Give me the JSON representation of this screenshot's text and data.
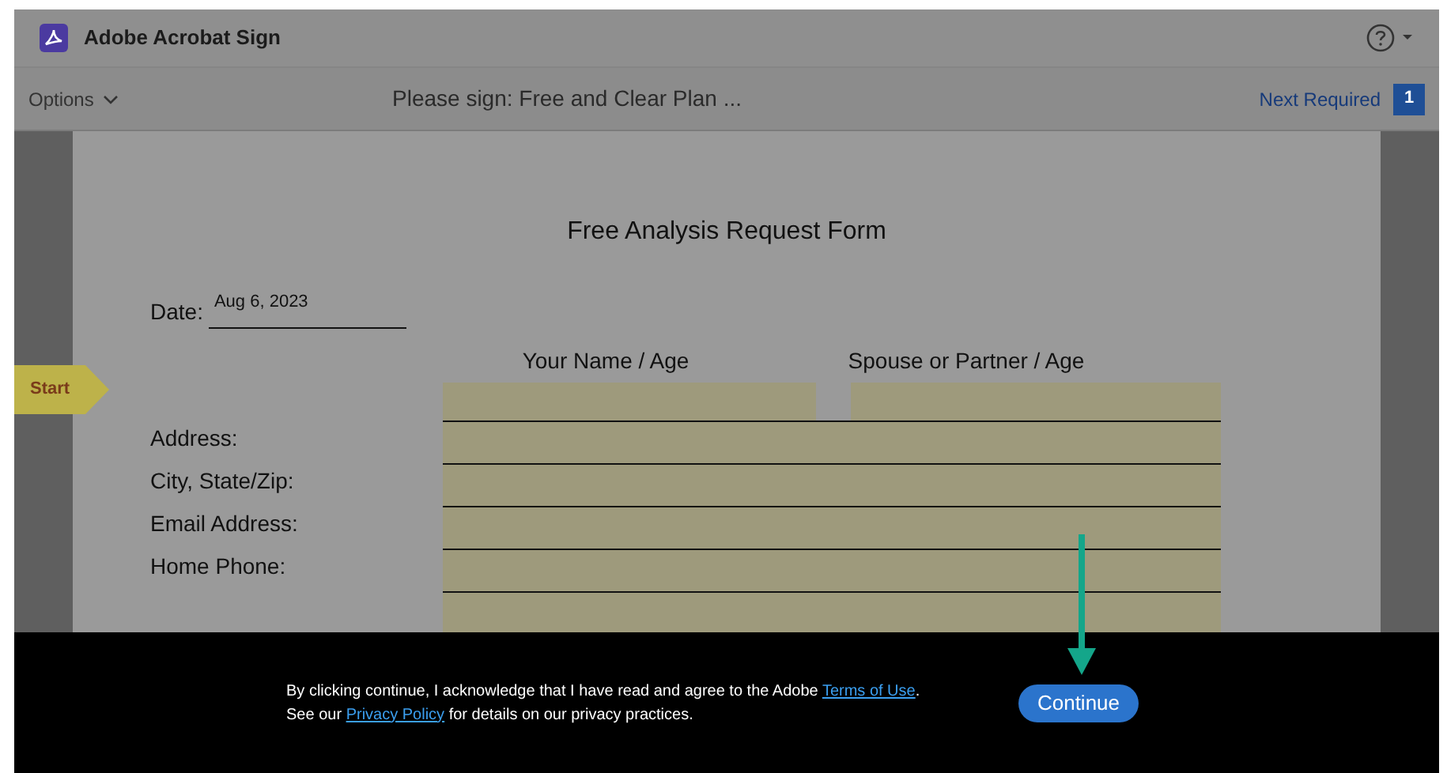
{
  "app": {
    "title": "Adobe Acrobat Sign"
  },
  "toolbar": {
    "options": "Options",
    "document_title": "Please sign: Free and Clear Plan ...",
    "next_required": "Next Required",
    "required_count": "1"
  },
  "start_tag": "Start",
  "form": {
    "title": "Free Analysis Request Form",
    "date_label": "Date:",
    "date_value": "Aug 6, 2023",
    "column_headers": [
      "Your Name / Age",
      "Spouse or Partner / Age"
    ],
    "rows": [
      "Address:",
      "City, State/Zip:",
      "Email Address:",
      "Home Phone:"
    ]
  },
  "consent": {
    "text_before": "By clicking continue, I acknowledge that I have read and agree to the Adobe ",
    "terms_link": "Terms of Use",
    "text_middle": ". See our ",
    "privacy_link": "Privacy Policy",
    "text_after": " for details on our privacy practices.",
    "button": "Continue"
  }
}
